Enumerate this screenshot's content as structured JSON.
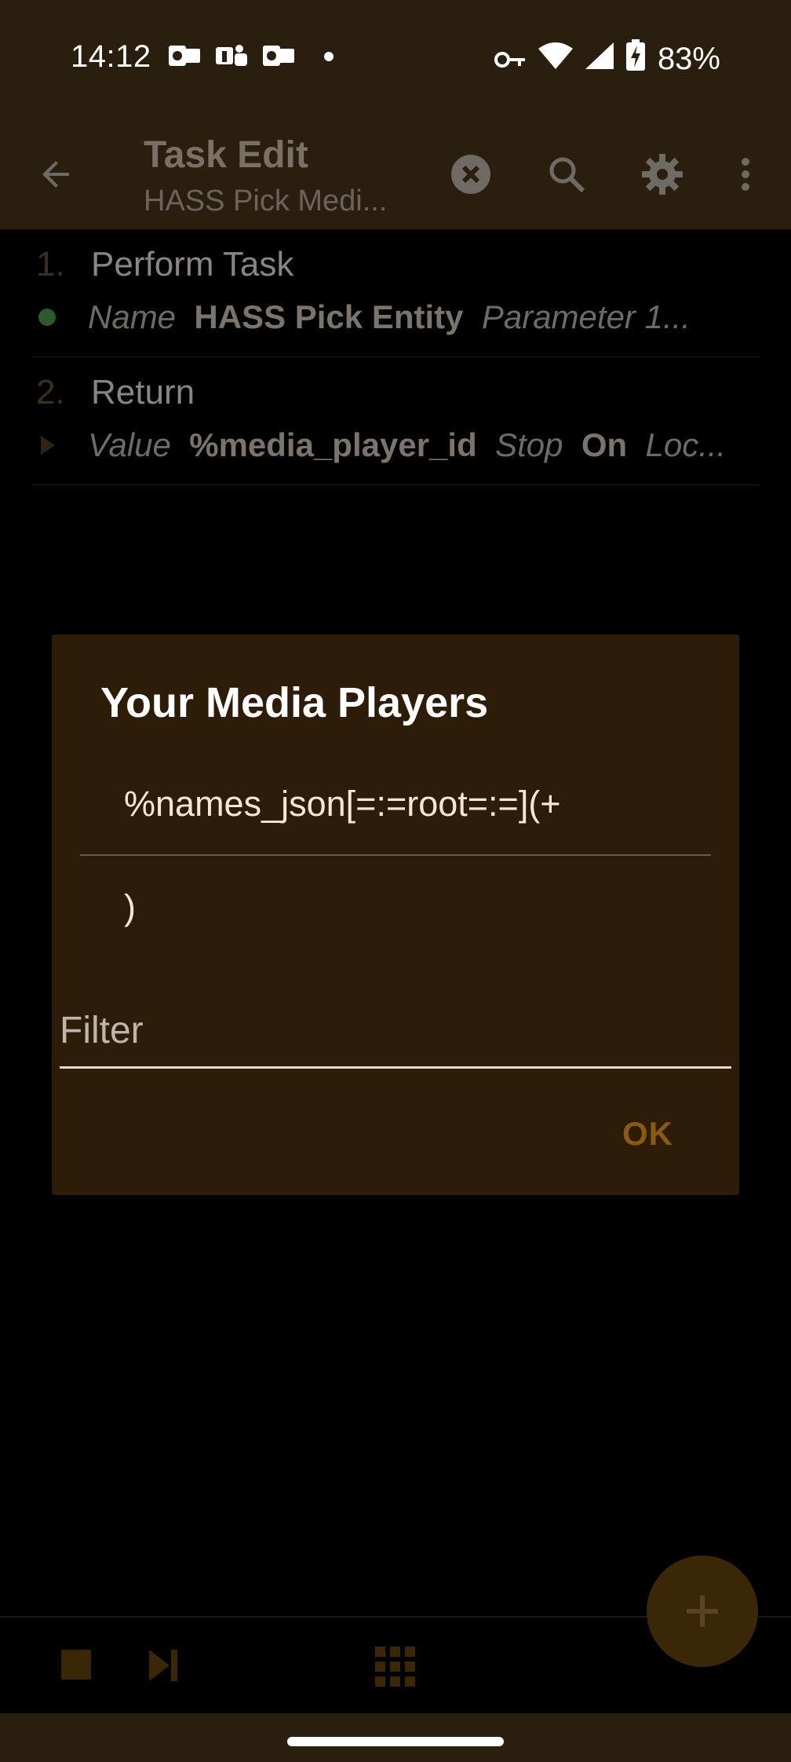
{
  "status_bar": {
    "time": "14:12",
    "battery": "83%",
    "icons_left": [
      "outlook-icon",
      "teams-icon",
      "outlook-icon",
      "dot-icon"
    ],
    "icons_right": [
      "vpn-key-icon",
      "wifi-icon",
      "signal-icon",
      "battery-charging-icon"
    ]
  },
  "app_bar": {
    "title": "Task Edit",
    "subtitle": "HASS Pick Medi..."
  },
  "tasks": [
    {
      "number": "1.",
      "name": "Perform Task",
      "params": [
        {
          "label": "Name",
          "value": "HASS Pick Entity"
        },
        {
          "label": "Parameter 1",
          "value": "..."
        }
      ],
      "marker": "green-dot"
    },
    {
      "number": "2.",
      "name": "Return",
      "params": [
        {
          "label": "Value",
          "value": "%media_player_id"
        },
        {
          "label": "Stop",
          "value": "On"
        },
        {
          "label": "Loc...",
          "value": ""
        }
      ],
      "marker": "triangle"
    }
  ],
  "dialog": {
    "title": "Your Media Players",
    "items": [
      "%names_json[=:=root=:=](+",
      ")"
    ],
    "filter_placeholder": "Filter",
    "ok_label": "OK"
  },
  "colors": {
    "bar_bg": "#2a1f0e",
    "dialog_bg": "#2d1d08",
    "accent": "#8b5a12",
    "fab_bg": "#3a2707"
  }
}
